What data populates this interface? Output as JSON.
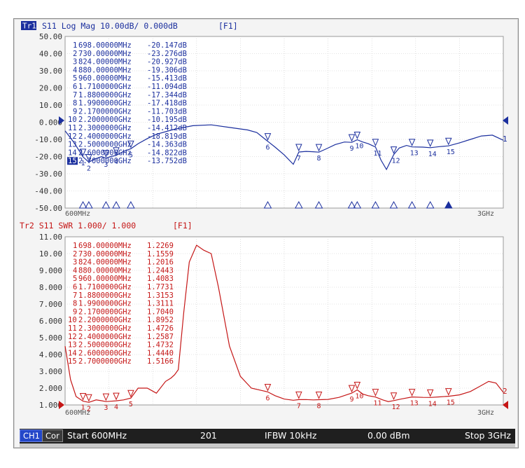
{
  "colors": {
    "trace1": "#1b2f9e",
    "trace2": "#c51616",
    "grid": "#c8c8c8",
    "bg": "#ffffff",
    "status_bg": "#1f1f1f",
    "tr1_badge_bg": "#1b2f9e",
    "active_marker_bg": "#1b2f9e"
  },
  "top": {
    "badge": "Tr1",
    "title": "S11 Log Mag 10.00dB/ 0.000dB",
    "tag": "[F1]",
    "y_ticks": [
      "50.00",
      "40.00",
      "30.00",
      "20.00",
      "10.00",
      "0.000",
      "-10.00",
      "-20.00",
      "-30.00",
      "-40.00",
      "-50.00"
    ],
    "x_start": "600MHz",
    "x_stop": "3GHz",
    "trace_label": "1",
    "markers": [
      {
        "n": "1",
        "freq": "698.00000MHz",
        "val": "-20.147dB"
      },
      {
        "n": "2",
        "freq": "730.00000MHz",
        "val": "-23.276dB"
      },
      {
        "n": "3",
        "freq": "824.00000MHz",
        "val": "-20.927dB"
      },
      {
        "n": "4",
        "freq": "880.00000MHz",
        "val": "-19.306dB"
      },
      {
        "n": "5",
        "freq": "960.00000MHz",
        "val": "-15.413dB"
      },
      {
        "n": "6",
        "freq": "1.7100000GHz",
        "val": "-11.094dB"
      },
      {
        "n": "7",
        "freq": "1.8800000GHz",
        "val": "-17.344dB"
      },
      {
        "n": "8",
        "freq": "1.9900000GHz",
        "val": "-17.418dB"
      },
      {
        "n": "9",
        "freq": "2.1700000GHz",
        "val": "-11.703dB"
      },
      {
        "n": "10",
        "freq": "2.2000000GHz",
        "val": "-10.195dB"
      },
      {
        "n": "11",
        "freq": "2.3000000GHz",
        "val": "-14.412dB"
      },
      {
        "n": "12",
        "freq": "2.4000000GHz",
        "val": "-18.819dB"
      },
      {
        "n": "13",
        "freq": "2.5000000GHz",
        "val": "-14.363dB"
      },
      {
        "n": "14",
        "freq": "2.6000000GHz",
        "val": "-14.822dB"
      },
      {
        "n": "15",
        "freq": "2.7000000GHz",
        "val": "-13.752dB"
      }
    ]
  },
  "bottom": {
    "title": "Tr2 S11 SWR 1.000/ 1.000",
    "tag": "[F1]",
    "y_ticks": [
      "11.00",
      "10.00",
      "9.000",
      "8.000",
      "7.000",
      "6.000",
      "5.000",
      "4.000",
      "3.000",
      "2.000",
      "1.000"
    ],
    "x_start": "600MHz",
    "x_stop": "3GHz",
    "trace_label": "2",
    "markers": [
      {
        "n": "1",
        "freq": "698.00000MHz",
        "val": "1.2269"
      },
      {
        "n": "2",
        "freq": "730.00000MHz",
        "val": "1.1559"
      },
      {
        "n": "3",
        "freq": "824.00000MHz",
        "val": "1.2016"
      },
      {
        "n": "4",
        "freq": "880.00000MHz",
        "val": "1.2443"
      },
      {
        "n": "5",
        "freq": "960.00000MHz",
        "val": "1.4083"
      },
      {
        "n": "6",
        "freq": "1.7100000GHz",
        "val": "1.7731"
      },
      {
        "n": "7",
        "freq": "1.8800000GHz",
        "val": "1.3153"
      },
      {
        "n": "8",
        "freq": "1.9900000GHz",
        "val": "1.3111"
      },
      {
        "n": "9",
        "freq": "2.1700000GHz",
        "val": "1.7040"
      },
      {
        "n": "10",
        "freq": "2.2000000GHz",
        "val": "1.8952"
      },
      {
        "n": "11",
        "freq": "2.3000000GHz",
        "val": "1.4726"
      },
      {
        "n": "12",
        "freq": "2.4000000GHz",
        "val": "1.2587"
      },
      {
        "n": "13",
        "freq": "2.5000000GHz",
        "val": "1.4732"
      },
      {
        "n": "14",
        "freq": "2.6000000GHz",
        "val": "1.4440"
      },
      {
        "n": "15",
        "freq": "2.7000000GHz",
        "val": "1.5166"
      }
    ]
  },
  "chart_data": [
    {
      "type": "line",
      "title": "S11 Log Mag 10.00dB/ 0.000dB",
      "ylim": [
        -50,
        50
      ],
      "xlim_ghz": [
        0.6,
        3.0
      ],
      "y_unit": "dB",
      "grid": true,
      "series": [
        {
          "x_ghz": [
            0.6,
            0.65,
            0.698,
            0.73,
            0.76,
            0.8,
            0.824,
            0.85,
            0.88,
            0.92,
            0.96,
            1.0,
            1.05,
            1.1,
            1.15,
            1.2,
            1.3,
            1.4,
            1.5,
            1.6,
            1.65,
            1.71,
            1.75,
            1.8,
            1.85,
            1.88,
            1.92,
            1.96,
            1.99,
            2.03,
            2.08,
            2.13,
            2.17,
            2.2,
            2.23,
            2.26,
            2.3,
            2.33,
            2.36,
            2.4,
            2.43,
            2.47,
            2.5,
            2.56,
            2.6,
            2.65,
            2.7,
            2.76,
            2.82,
            2.88,
            2.94,
            3.0
          ],
          "y": [
            -5.0,
            -12.0,
            -20.147,
            -23.276,
            -21.5,
            -20.0,
            -20.927,
            -20.0,
            -19.306,
            -17.0,
            -15.413,
            -12.5,
            -9.5,
            -7.0,
            -5.5,
            -4.0,
            -2.0,
            -1.5,
            -3.0,
            -4.5,
            -6.0,
            -11.094,
            -14.5,
            -19.0,
            -24.5,
            -17.344,
            -17.0,
            -17.2,
            -17.418,
            -15.5,
            -13.0,
            -11.5,
            -11.703,
            -10.195,
            -11.5,
            -12.5,
            -14.412,
            -22.0,
            -27.5,
            -18.819,
            -15.0,
            -13.5,
            -14.363,
            -14.5,
            -14.822,
            -14.2,
            -13.752,
            -12.0,
            -10.0,
            -8.0,
            -7.5,
            -10.5
          ]
        }
      ],
      "markers_ghz": [
        0.698,
        0.73,
        0.824,
        0.88,
        0.96,
        1.71,
        1.88,
        1.99,
        2.17,
        2.2,
        2.3,
        2.4,
        2.5,
        2.6,
        2.7
      ],
      "marker_values": [
        -20.147,
        -23.276,
        -20.927,
        -19.306,
        -15.413,
        -11.094,
        -17.344,
        -17.418,
        -11.703,
        -10.195,
        -14.412,
        -18.819,
        -14.363,
        -14.822,
        -13.752
      ],
      "reference_level": 0.0
    },
    {
      "type": "line",
      "title": "S11 SWR 1.000/ 1.000",
      "ylim": [
        1,
        11
      ],
      "xlim_ghz": [
        0.6,
        3.0
      ],
      "grid": true,
      "series": [
        {
          "x_ghz": [
            0.6,
            0.63,
            0.66,
            0.698,
            0.73,
            0.77,
            0.8,
            0.824,
            0.85,
            0.88,
            0.92,
            0.96,
            1.0,
            1.05,
            1.1,
            1.15,
            1.18,
            1.2,
            1.22,
            1.25,
            1.28,
            1.32,
            1.36,
            1.4,
            1.44,
            1.5,
            1.56,
            1.62,
            1.68,
            1.71,
            1.75,
            1.8,
            1.85,
            1.88,
            1.92,
            1.96,
            1.99,
            2.04,
            2.1,
            2.17,
            2.2,
            2.23,
            2.26,
            2.3,
            2.34,
            2.37,
            2.4,
            2.44,
            2.5,
            2.56,
            2.6,
            2.65,
            2.7,
            2.76,
            2.82,
            2.87,
            2.92,
            2.96,
            3.0
          ],
          "y": [
            4.5,
            2.5,
            1.5,
            1.2269,
            1.1559,
            1.3,
            1.25,
            1.2016,
            1.22,
            1.2443,
            1.3,
            1.4083,
            2.0,
            2.0,
            1.7,
            2.4,
            2.6,
            2.8,
            3.1,
            6.5,
            9.5,
            10.5,
            10.2,
            10.0,
            8.0,
            4.5,
            2.7,
            2.0,
            1.85,
            1.7731,
            1.55,
            1.35,
            1.28,
            1.3153,
            1.32,
            1.3,
            1.3111,
            1.33,
            1.45,
            1.704,
            1.8952,
            1.65,
            1.55,
            1.4726,
            1.3,
            1.2,
            1.2587,
            1.35,
            1.4732,
            1.45,
            1.444,
            1.48,
            1.5166,
            1.6,
            1.8,
            2.1,
            2.4,
            2.3,
            1.75
          ]
        }
      ],
      "markers_ghz": [
        0.698,
        0.73,
        0.824,
        0.88,
        0.96,
        1.71,
        1.88,
        1.99,
        2.17,
        2.2,
        2.3,
        2.4,
        2.5,
        2.6,
        2.7
      ],
      "marker_values": [
        1.2269,
        1.1559,
        1.2016,
        1.2443,
        1.4083,
        1.7731,
        1.3153,
        1.3111,
        1.704,
        1.8952,
        1.4726,
        1.2587,
        1.4732,
        1.444,
        1.5166
      ],
      "reference_level": 1.0
    }
  ],
  "status": {
    "channel": "CH1",
    "cor": "Cor",
    "start": "Start 600MHz",
    "points": "201",
    "ifbw": "IFBW 10kHz",
    "power": "0.00 dBm",
    "stop": "Stop 3GHz"
  }
}
